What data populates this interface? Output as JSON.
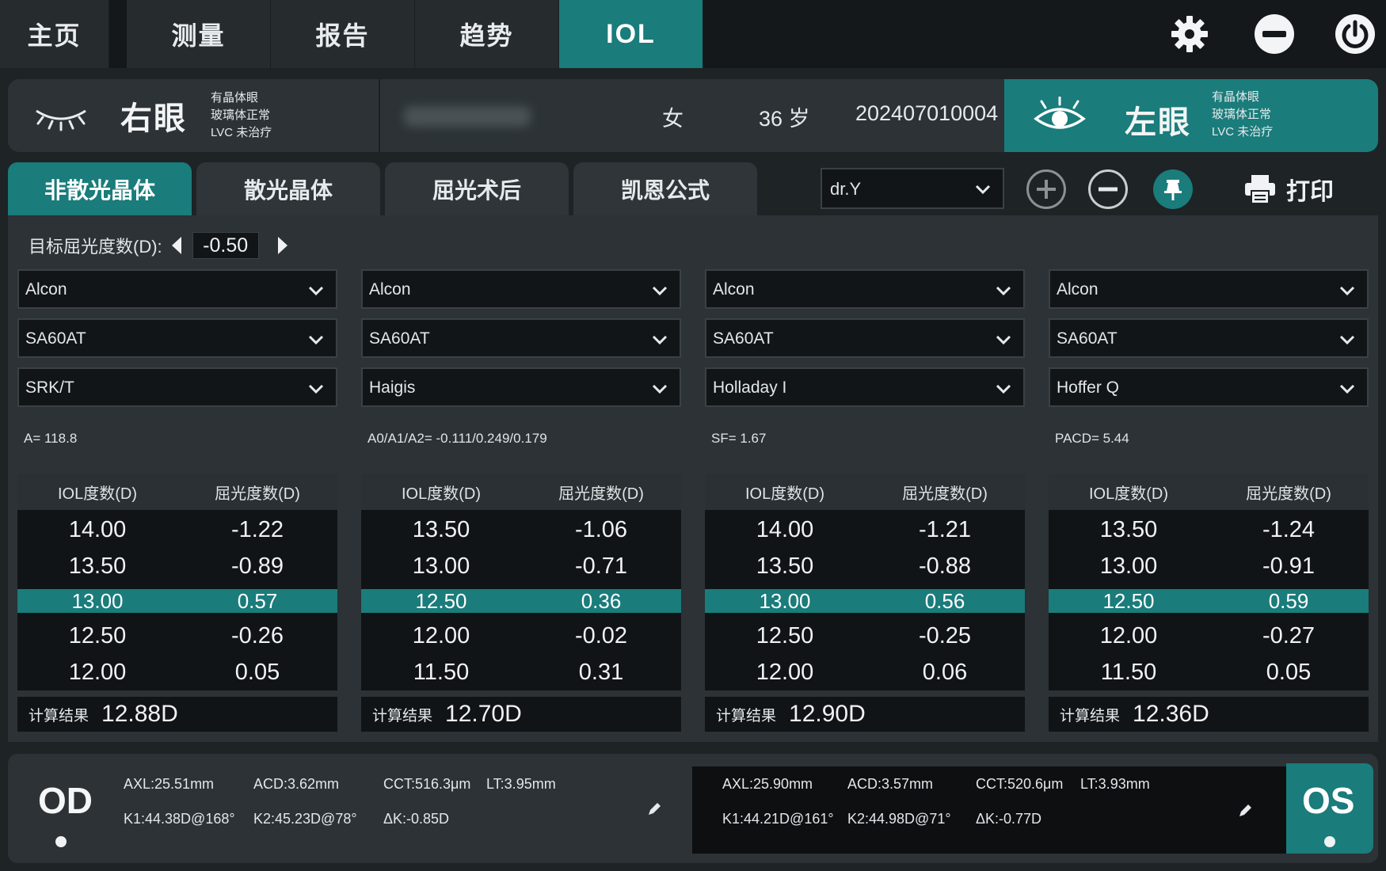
{
  "nav": {
    "tabs": [
      "主页",
      "测量",
      "报告",
      "趋势",
      "IOL"
    ],
    "active_index": 4,
    "icons": [
      "gear-icon",
      "minus-circle-icon",
      "power-icon"
    ]
  },
  "patient": {
    "right_eye": {
      "label": "右眼",
      "status": [
        "有晶体眼",
        "玻璃体正常",
        "LVC 未治疗"
      ]
    },
    "left_eye": {
      "label": "左眼",
      "status": [
        "有晶体眼",
        "玻璃体正常",
        "LVC 未治疗"
      ]
    },
    "name_blurred": "",
    "sex": "女",
    "age": "36 岁",
    "id": "202407010004"
  },
  "subtabs": {
    "items": [
      "非散光晶体",
      "散光晶体",
      "屈光术后",
      "凯恩公式"
    ],
    "active_index": 0
  },
  "toolbar": {
    "doctor_select": "dr.Y",
    "print_label": "打印"
  },
  "target": {
    "label": "目标屈光度数(D):",
    "value": "-0.50"
  },
  "columns": [
    {
      "manufacturer": "Alcon",
      "model": "SA60AT",
      "formula": "SRK/T",
      "constant": "A= 118.8",
      "header": [
        "IOL度数(D)",
        "屈光度数(D)"
      ],
      "rows": [
        [
          "14.00",
          "-1.22"
        ],
        [
          "13.50",
          "-0.89"
        ],
        [
          "13.00",
          "0.57"
        ],
        [
          "12.50",
          "-0.26"
        ],
        [
          "12.00",
          "0.05"
        ]
      ],
      "selected_row": 2,
      "result_label": "计算结果",
      "result_value": "12.88D"
    },
    {
      "manufacturer": "Alcon",
      "model": "SA60AT",
      "formula": "Haigis",
      "constant": "A0/A1/A2= -0.111/0.249/0.179",
      "header": [
        "IOL度数(D)",
        "屈光度数(D)"
      ],
      "rows": [
        [
          "13.50",
          "-1.06"
        ],
        [
          "13.00",
          "-0.71"
        ],
        [
          "12.50",
          "0.36"
        ],
        [
          "12.00",
          "-0.02"
        ],
        [
          "11.50",
          "0.31"
        ]
      ],
      "selected_row": 2,
      "result_label": "计算结果",
      "result_value": "12.70D"
    },
    {
      "manufacturer": "Alcon",
      "model": "SA60AT",
      "formula": "Holladay I",
      "constant": "SF= 1.67",
      "header": [
        "IOL度数(D)",
        "屈光度数(D)"
      ],
      "rows": [
        [
          "14.00",
          "-1.21"
        ],
        [
          "13.50",
          "-0.88"
        ],
        [
          "13.00",
          "0.56"
        ],
        [
          "12.50",
          "-0.25"
        ],
        [
          "12.00",
          "0.06"
        ]
      ],
      "selected_row": 2,
      "result_label": "计算结果",
      "result_value": "12.90D"
    },
    {
      "manufacturer": "Alcon",
      "model": "SA60AT",
      "formula": "Hoffer Q",
      "constant": "PACD= 5.44",
      "header": [
        "IOL度数(D)",
        "屈光度数(D)"
      ],
      "rows": [
        [
          "13.50",
          "-1.24"
        ],
        [
          "13.00",
          "-0.91"
        ],
        [
          "12.50",
          "0.59"
        ],
        [
          "12.00",
          "-0.27"
        ],
        [
          "11.50",
          "0.05"
        ]
      ],
      "selected_row": 2,
      "result_label": "计算结果",
      "result_value": "12.36D"
    }
  ],
  "biometry": {
    "od": {
      "label": "OD",
      "axl": "AXL:25.51mm",
      "acd": "ACD:3.62mm",
      "cct": "CCT:516.3μm",
      "lt": "LT:3.95mm",
      "k1": "K1:44.38D@168°",
      "k2": "K2:45.23D@78°",
      "dk": "ΔK:-0.85D"
    },
    "os": {
      "label": "OS",
      "axl": "AXL:25.90mm",
      "acd": "ACD:3.57mm",
      "cct": "CCT:520.6μm",
      "lt": "LT:3.93mm",
      "k1": "K1:44.21D@161°",
      "k2": "K2:44.98D@71°",
      "dk": "ΔK:-0.77D"
    }
  },
  "colors": {
    "accent": "#1a7c7b",
    "bg": "#1e2326",
    "panel": "#2c3236",
    "field": "#121517"
  }
}
